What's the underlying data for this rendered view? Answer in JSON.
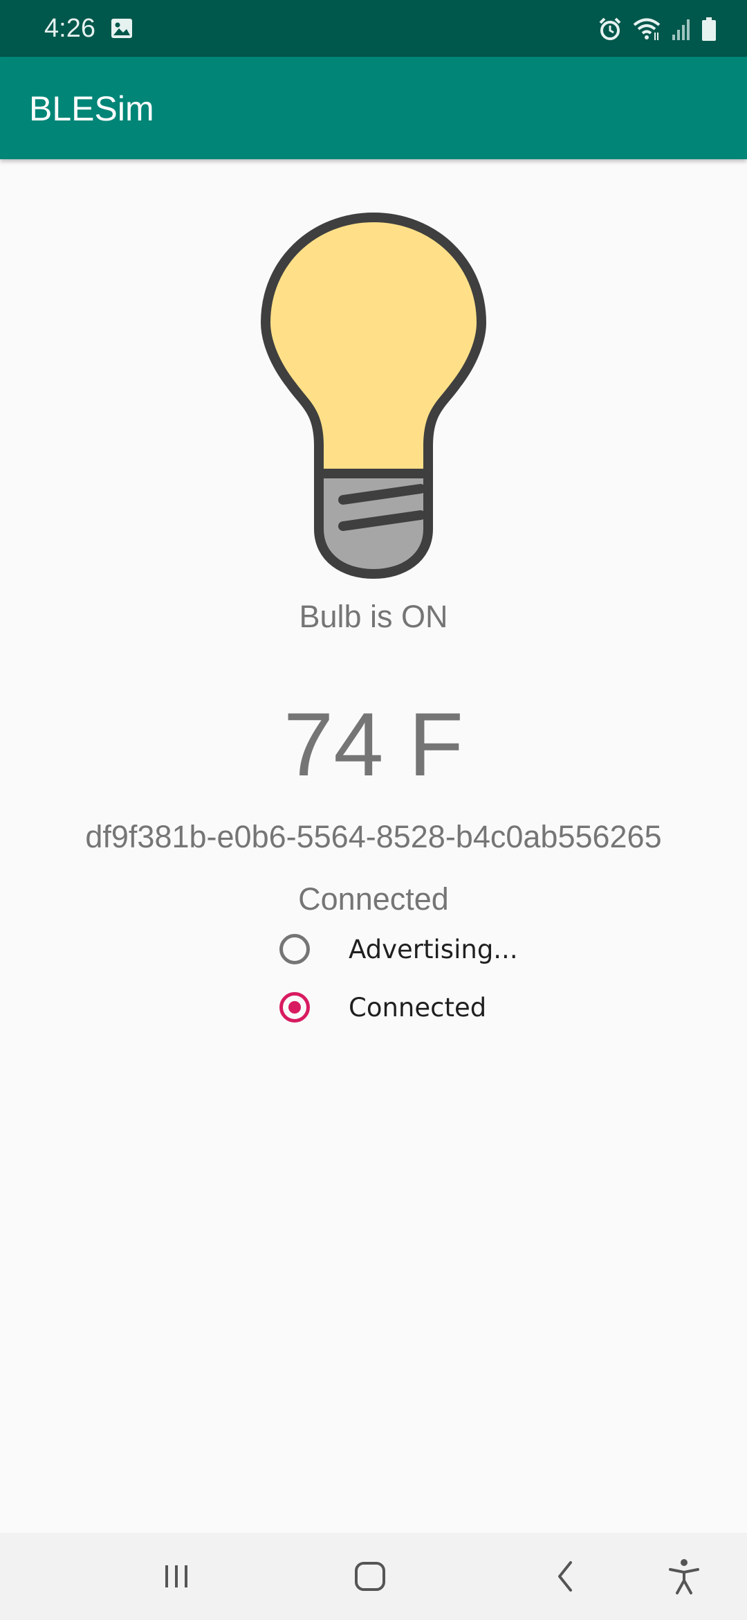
{
  "status_bar": {
    "time": "4:26",
    "icons": [
      "gallery-icon",
      "alarm-icon",
      "wifi-icon",
      "signal-icon",
      "battery-icon"
    ]
  },
  "app_bar": {
    "title": "BLESim",
    "color": "#008577"
  },
  "main": {
    "bulb_status": "Bulb is ON",
    "temperature": "74 F",
    "device_id": "df9f381b-e0b6-5564-8528-b4c0ab556265",
    "connection_status": "Connected",
    "bulb_colors": {
      "glass": "#ffe088",
      "outline": "#3f3f3f",
      "base": "#a6a6a6"
    },
    "options": [
      {
        "label": "Advertising...",
        "checked": false
      },
      {
        "label": "Connected",
        "checked": true
      }
    ],
    "accent": "#d81b60"
  },
  "nav_bar": {
    "icons": [
      "recent-apps-icon",
      "home-icon",
      "back-icon",
      "accessibility-icon"
    ]
  }
}
